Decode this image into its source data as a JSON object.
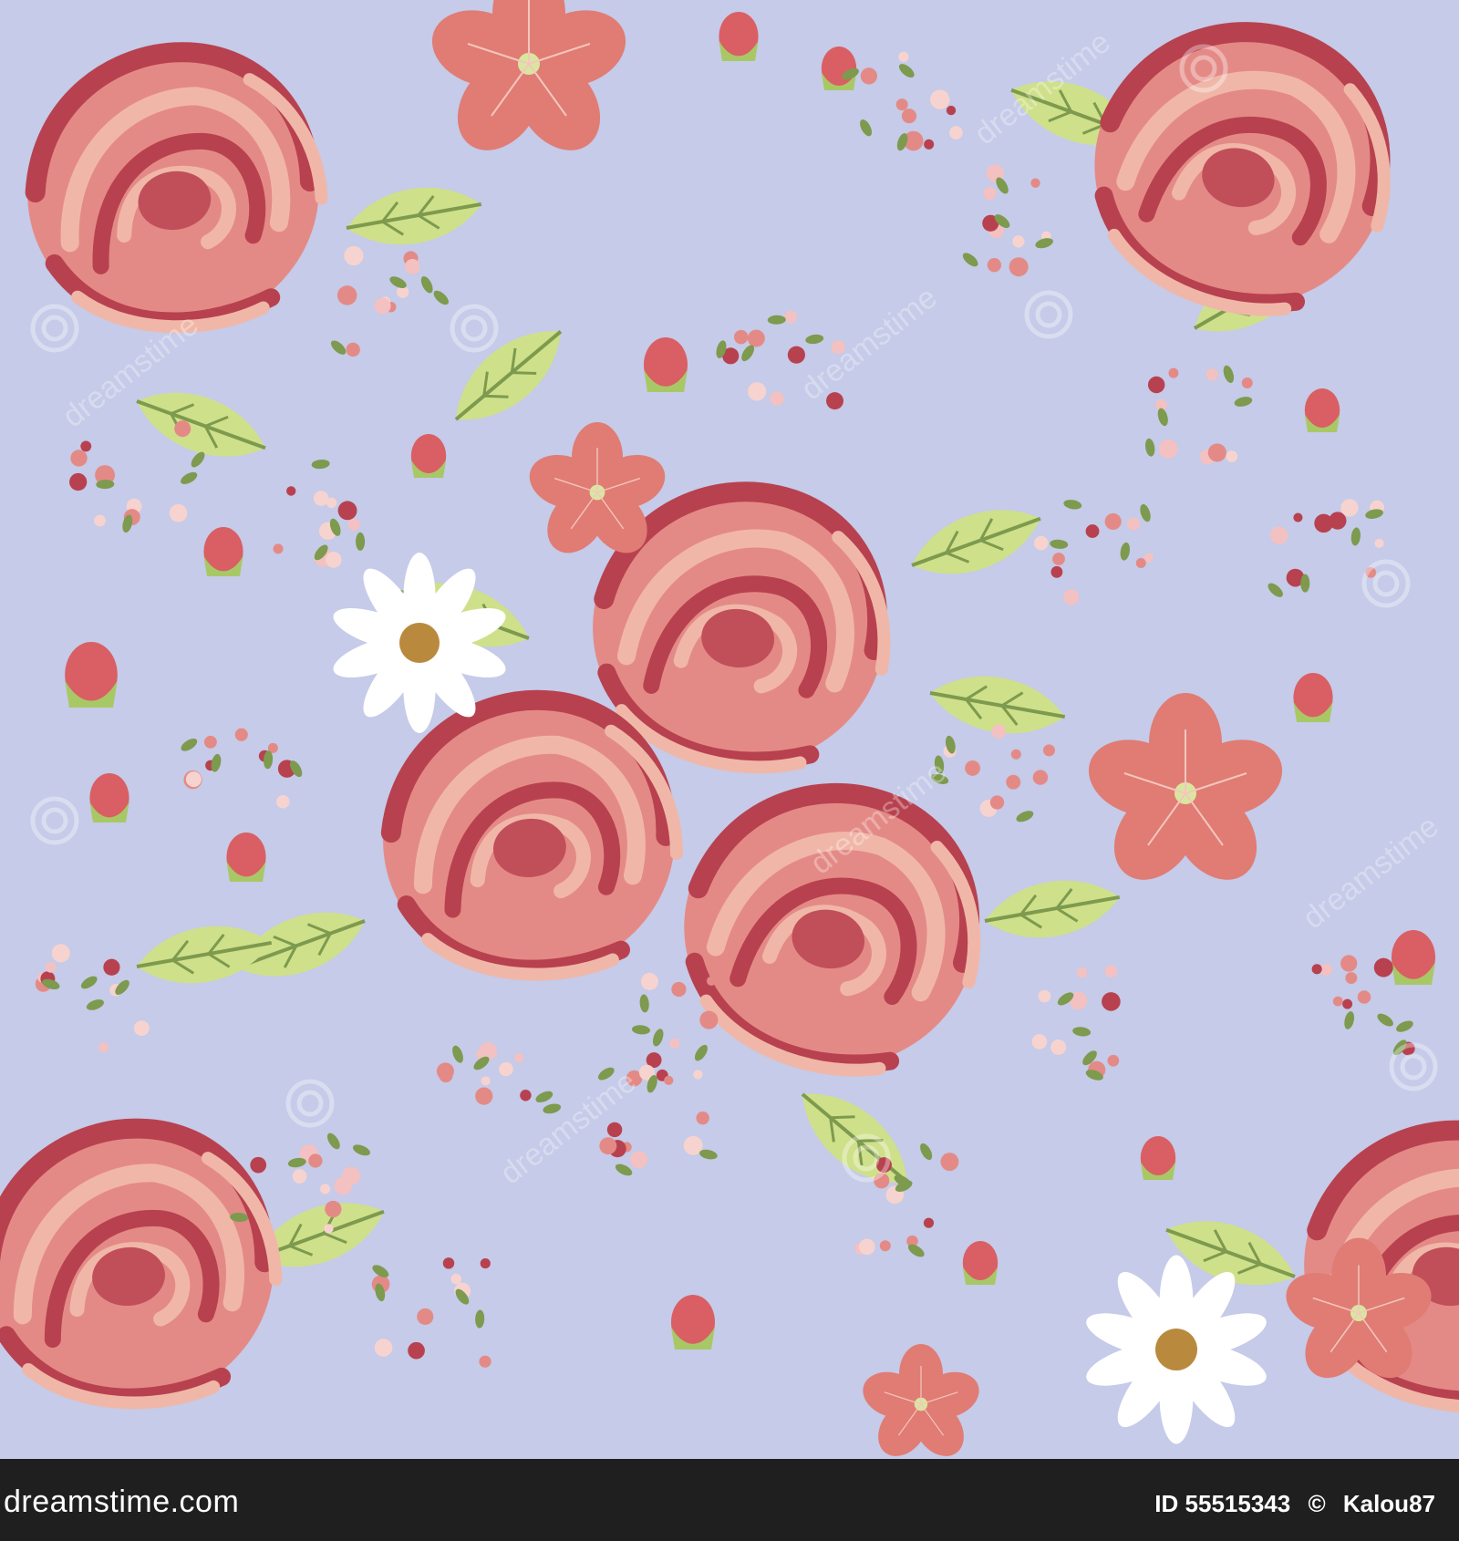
{
  "image": {
    "subject": "seamless-floral-wallpaper-pattern",
    "background_color": "#c5cbe8",
    "colors": {
      "rose_light": "#f0b7a8",
      "rose_mid": "#e48a86",
      "rose_dark": "#b8414f",
      "blossom": "#e07c74",
      "leaf": "#cfe08a",
      "leaf_dark": "#7d9a4e",
      "daisy": "#ffffff",
      "daisy_center": "#b98a3e"
    },
    "watermark_text": "dreamstime"
  },
  "footer": {
    "site": "dreamstime.com",
    "id_label": "ID 55515343",
    "copyright": "©",
    "author": "Kalou87"
  }
}
